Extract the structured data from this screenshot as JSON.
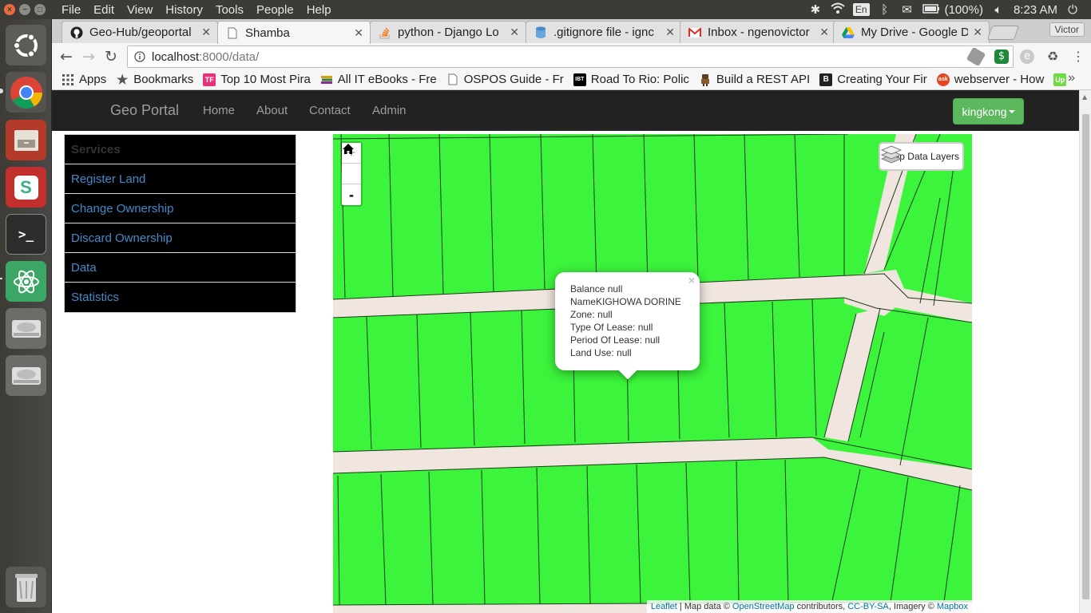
{
  "system_bar": {
    "menu": [
      "File",
      "Edit",
      "View",
      "History",
      "Tools",
      "People",
      "Help"
    ],
    "input_lang": "En",
    "battery": "(100%)",
    "clock": "8:23 AM"
  },
  "browser": {
    "tabs": [
      {
        "title": "Geo-Hub/geoportal",
        "icon": "github-icon"
      },
      {
        "title": "Shamba",
        "icon": "page-icon"
      },
      {
        "title": "python - Django Lo",
        "icon": "stackoverflow-icon"
      },
      {
        "title": ".gitignore file - ignc",
        "icon": "database-icon"
      },
      {
        "title": "Inbox - ngenovictor",
        "icon": "gmail-icon"
      },
      {
        "title": "My Drive - Google D",
        "icon": "google-drive-icon"
      }
    ],
    "profile_name": "Victor",
    "url_host": "localhost",
    "url_path": ":8000/data/",
    "bookmarks": [
      {
        "label": "Apps",
        "icon": "apps-grid-icon"
      },
      {
        "label": "Bookmarks",
        "icon": "star-icon"
      },
      {
        "label": "Top 10 Most Pira",
        "icon": "tf-icon"
      },
      {
        "label": "All IT eBooks - Fre",
        "icon": "books-icon"
      },
      {
        "label": "OSPOS Guide - Fr",
        "icon": "page-icon"
      },
      {
        "label": "Road To Rio: Polic",
        "icon": "ibt-icon"
      },
      {
        "label": "Build a REST API",
        "icon": "robot-icon"
      },
      {
        "label": "Creating Your Fir",
        "icon": "b-icon"
      },
      {
        "label": "webserver - How",
        "icon": "ask-icon"
      },
      {
        "label": "",
        "icon": "upwork-icon"
      }
    ]
  },
  "site": {
    "brand": "Geo Portal",
    "nav": [
      "Home",
      "About",
      "Contact",
      "Admin"
    ],
    "user": "kingkong"
  },
  "sidebar": {
    "header": "Services",
    "items": [
      "Register Land",
      "Change Ownership",
      "Discard Ownership",
      "Data",
      "Statistics"
    ]
  },
  "map": {
    "parcel_color": "#3cf43c",
    "road_color": "#f0e6df",
    "zoom_in": "+",
    "zoom_out": "-",
    "home_icon": "home-icon",
    "layers_label": "Map Data Layers",
    "popup": {
      "close": "×",
      "lines": [
        "Balance null",
        "NameKIGHOWA DORINE",
        "Zone: null",
        "Type Of Lease: null",
        "Period Of Lease: null",
        "Land Use: null"
      ]
    },
    "attribution": {
      "leaflet": "Leaflet",
      "sep1": " | Map data © ",
      "osm": "OpenStreetMap",
      "sep2": " contributors, ",
      "license": "CC-BY-SA",
      "sep3": ", Imagery © ",
      "provider": "Mapbox"
    }
  }
}
